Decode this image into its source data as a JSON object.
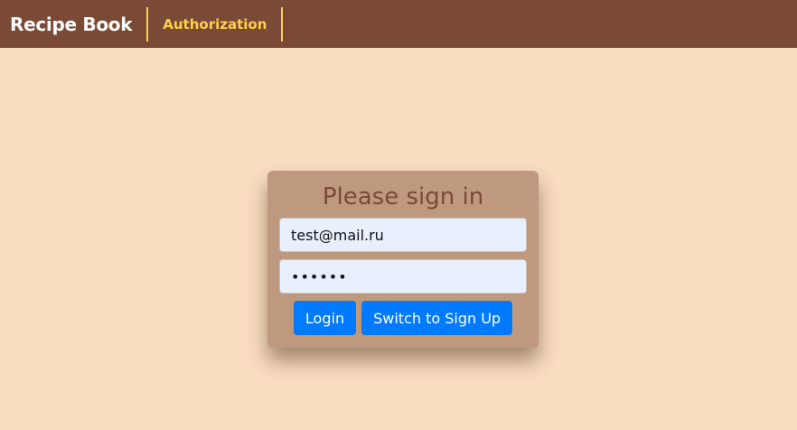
{
  "navbar": {
    "brand": "Recipe Book",
    "link_label": "Authorization"
  },
  "login": {
    "title": "Please sign in",
    "email_value": "test@mail.ru",
    "password_display": "••••••",
    "login_label": "Login",
    "switch_label": "Switch to Sign Up"
  },
  "colors": {
    "page_bg": "#f9ddbf",
    "navbar_bg": "#7a4a37",
    "nav_link": "#ffcf4a",
    "card_bg": "#be997e",
    "title_color": "#7a4a37",
    "button_bg": "#007bff",
    "input_bg": "#e8f0fe"
  }
}
